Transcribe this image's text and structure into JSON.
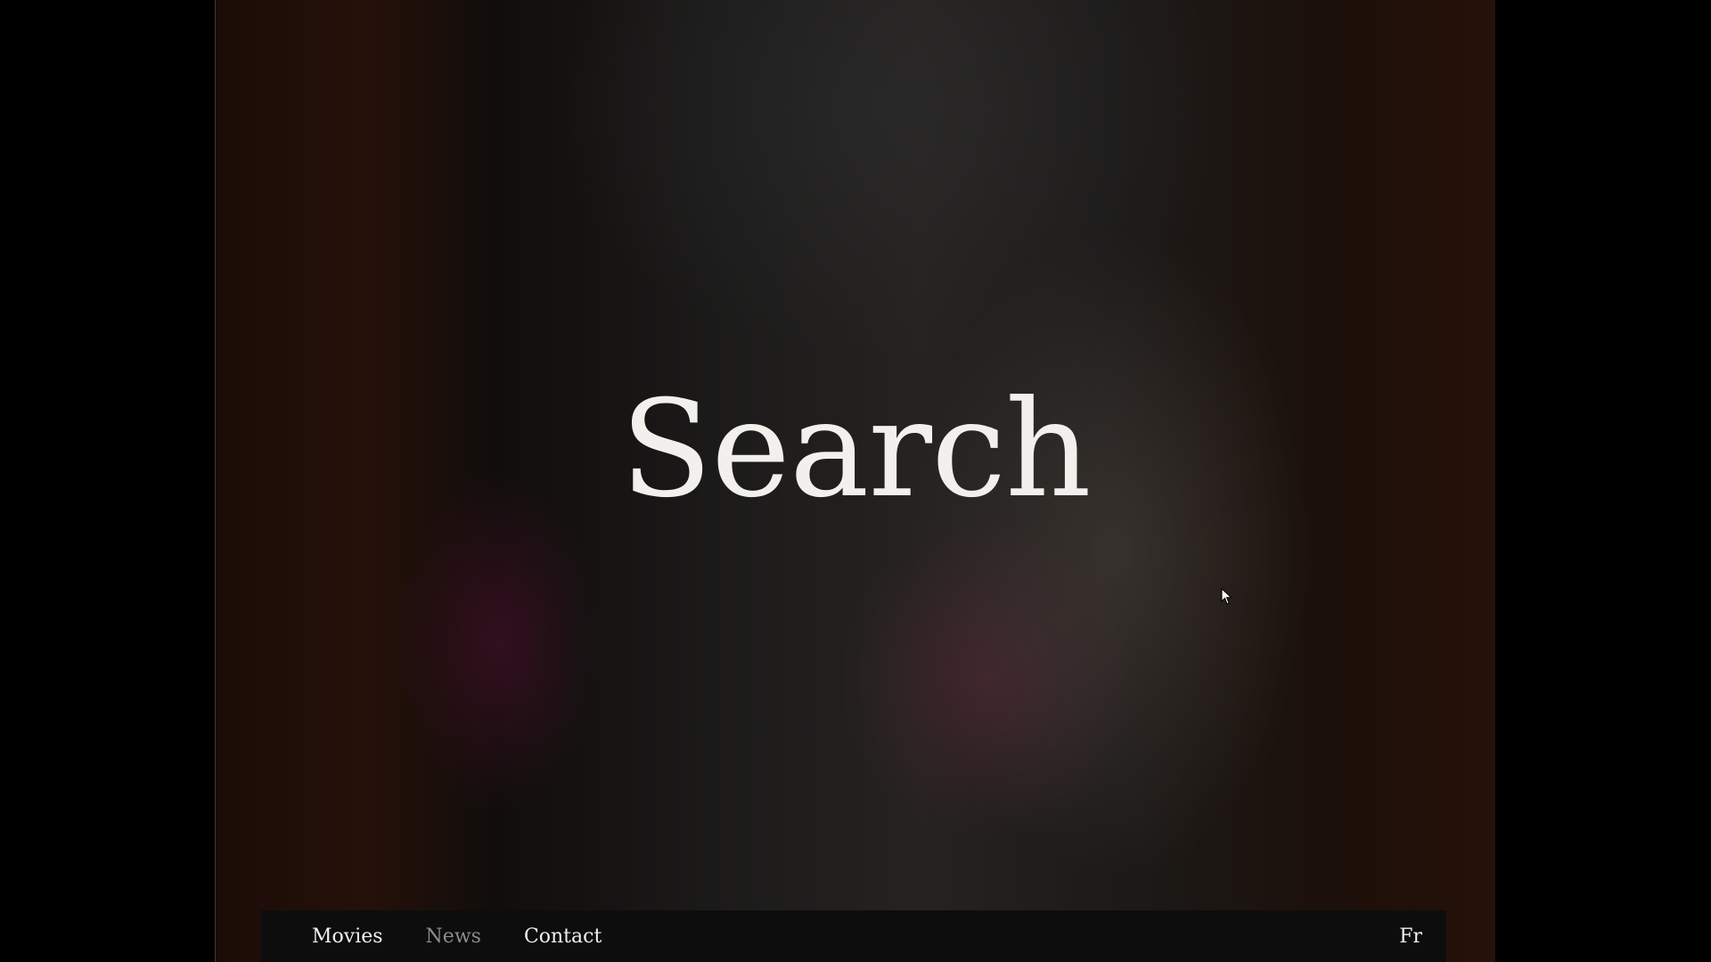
{
  "hero": {
    "title": "Search"
  },
  "nav": {
    "items": [
      {
        "label": "Movies",
        "active": true
      },
      {
        "label": "News",
        "active": false
      },
      {
        "label": "Contact",
        "active": true
      }
    ],
    "language_toggle": "Fr"
  },
  "colors": {
    "background": "#000000",
    "text": "#f2f0ec",
    "inactive_text": "#8f8c88",
    "navbar": "#0d0d0d"
  }
}
